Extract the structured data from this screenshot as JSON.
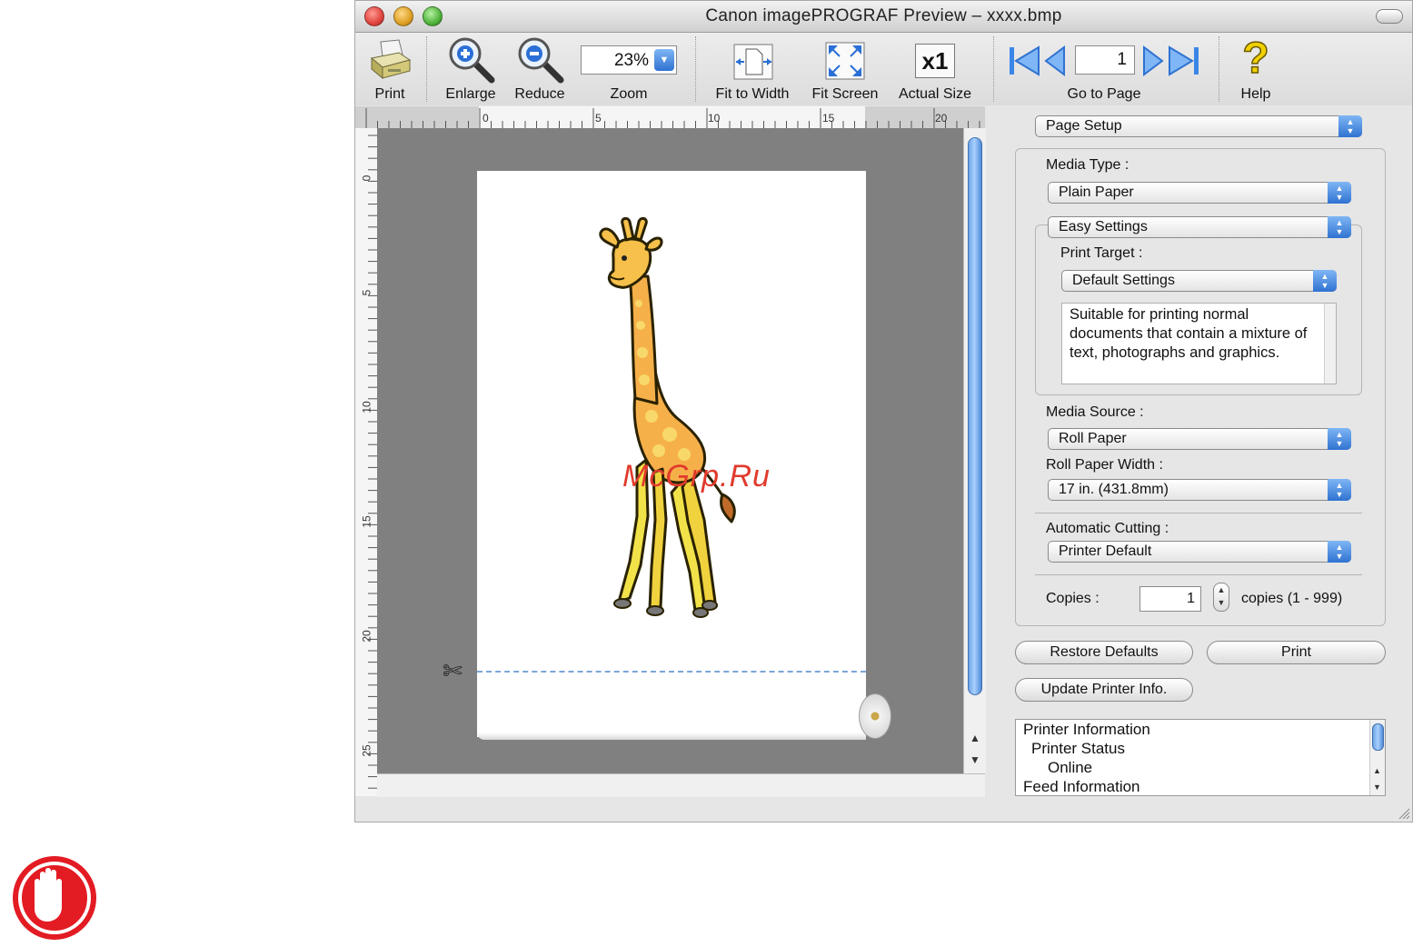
{
  "window": {
    "title": "Canon imagePROGRAF Preview – xxxx.bmp",
    "colors": {
      "close": "#e0443e",
      "minimize": "#dea123",
      "zoom": "#4fb33a",
      "accent": "#3a7bd5"
    }
  },
  "toolbar": {
    "print": "Print",
    "enlarge": "Enlarge",
    "reduce": "Reduce",
    "zoom_value": "23%",
    "zoom": "Zoom",
    "fit_width": "Fit to Width",
    "fit_screen": "Fit Screen",
    "actual_size_glyph": "x1",
    "actual_size": "Actual Size",
    "page_number": "1",
    "go_to_page": "Go to Page",
    "help": "Help"
  },
  "ruler": {
    "h_ticks": [
      "0",
      "5",
      "10",
      "15",
      "20"
    ],
    "v_ticks": [
      "0",
      "5",
      "10",
      "15",
      "20",
      "25"
    ]
  },
  "panel": {
    "section_select": "Page Setup",
    "media_type_label": "Media Type :",
    "media_type_value": "Plain Paper",
    "settings_mode": "Easy Settings",
    "print_target_label": "Print Target :",
    "print_target_value": "Default Settings",
    "print_target_desc": "Suitable for printing normal documents that contain a mixture of text, photographs and graphics.",
    "media_source_label": "Media Source :",
    "media_source_value": "Roll Paper",
    "roll_width_label": "Roll Paper Width :",
    "roll_width_value": "17 in. (431.8mm)",
    "auto_cut_label": "Automatic Cutting :",
    "auto_cut_value": "Printer Default",
    "copies_label": "Copies :",
    "copies_value": "1",
    "copies_range": "copies (1 - 999)",
    "restore_defaults": "Restore Defaults",
    "print_button": "Print",
    "update_info": "Update Printer Info."
  },
  "info_tree": [
    "Printer Information",
    "Printer Status",
    "Online",
    "Feed Information"
  ],
  "watermark": "McGrp.Ru"
}
